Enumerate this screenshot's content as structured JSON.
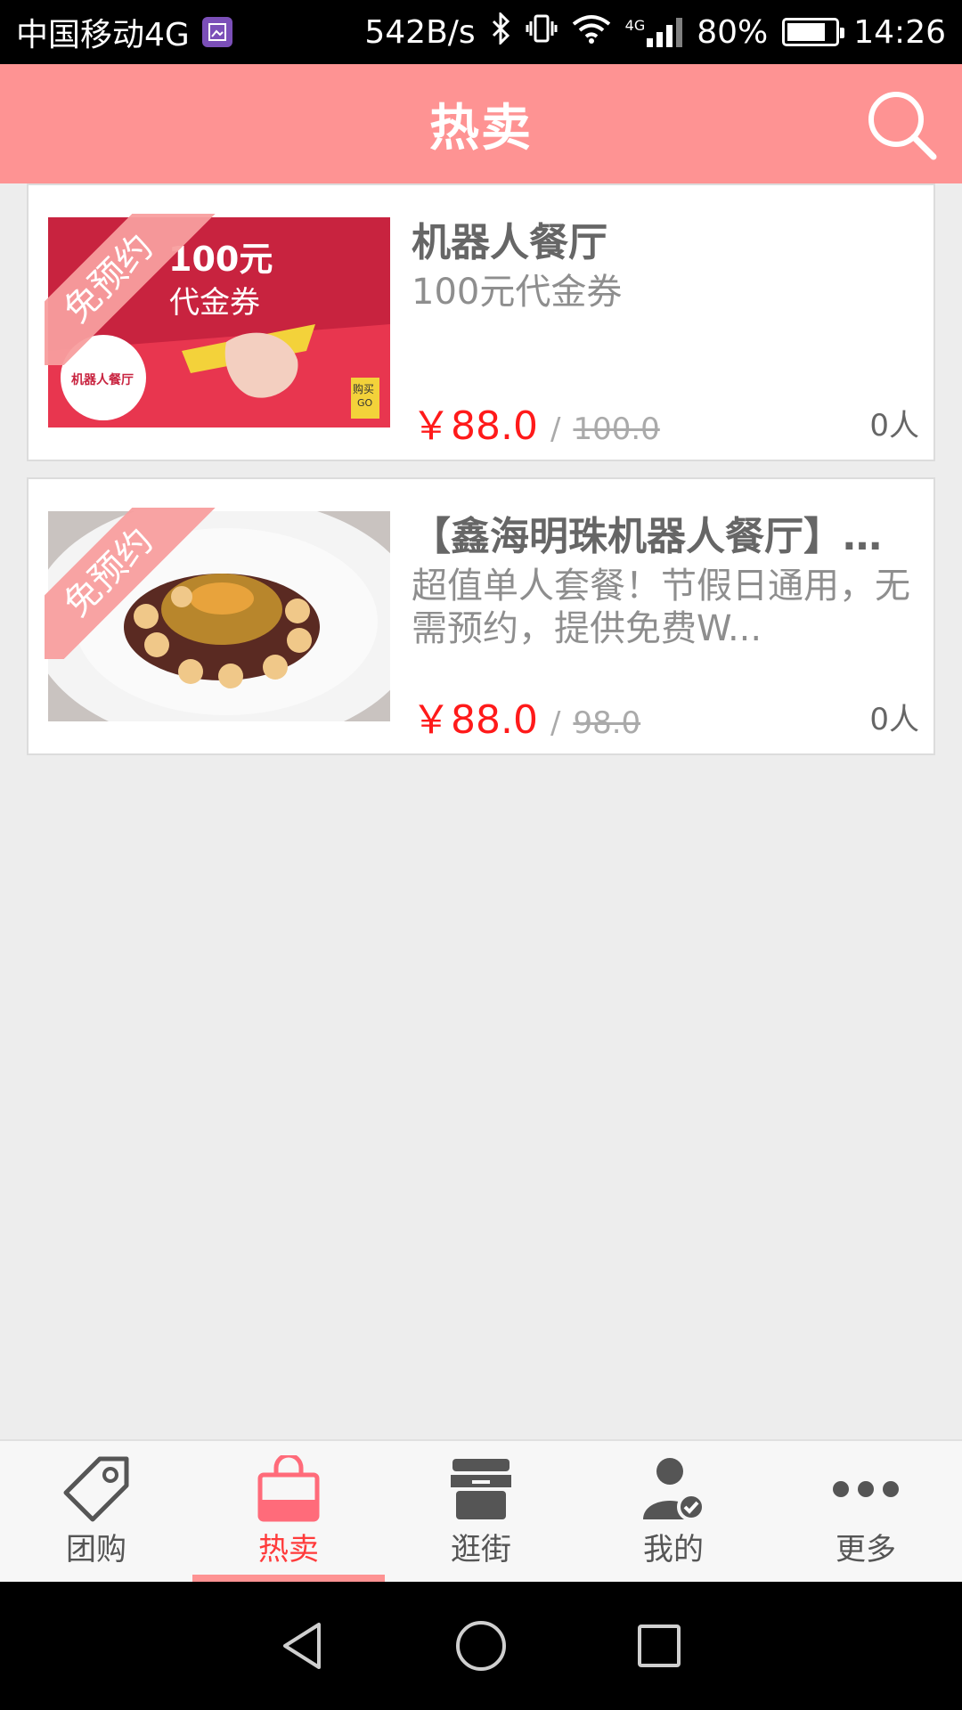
{
  "status_bar": {
    "carrier": "中国移动4G",
    "net_speed": "542B/s",
    "network_type": "4G",
    "battery": "80%",
    "battery_level": 0.8,
    "time": "14:26"
  },
  "header": {
    "title": "热卖",
    "search_icon": "search-icon",
    "background": "#fe9393"
  },
  "deals": [
    {
      "badge": "免预约",
      "title": "机器人餐厅",
      "desc": "100元代金券",
      "price": "￥88.0",
      "separator": "/",
      "original_price": "100.0",
      "sold": "0人",
      "image": {
        "amount": "100元",
        "caption": "代金券",
        "logo_text": "机器人餐厅",
        "button_text": "购买",
        "button_sub": "GO"
      }
    },
    {
      "badge": "免预约",
      "title": "【鑫海明珠机器人餐厅】单...",
      "desc": "超值单人套餐！节假日通用，无需预约，提供免费W...",
      "price": "￥88.0",
      "separator": "/",
      "original_price": "98.0",
      "sold": "0人",
      "image": {}
    }
  ],
  "bottom_nav": {
    "items": [
      {
        "label": "团购",
        "icon": "tag-icon",
        "active": false
      },
      {
        "label": "热卖",
        "icon": "shopping-bag-icon",
        "active": true
      },
      {
        "label": "逛街",
        "icon": "storefront-icon",
        "active": false
      },
      {
        "label": "我的",
        "icon": "user-check-icon",
        "active": false
      },
      {
        "label": "更多",
        "icon": "more-dots-icon",
        "active": false
      }
    ],
    "active_color": "#ff3b3b"
  },
  "system_nav": [
    "back-icon",
    "home-icon",
    "recents-icon"
  ],
  "colors": {
    "accent": "#fe9393",
    "price": "#ff1a1a"
  }
}
